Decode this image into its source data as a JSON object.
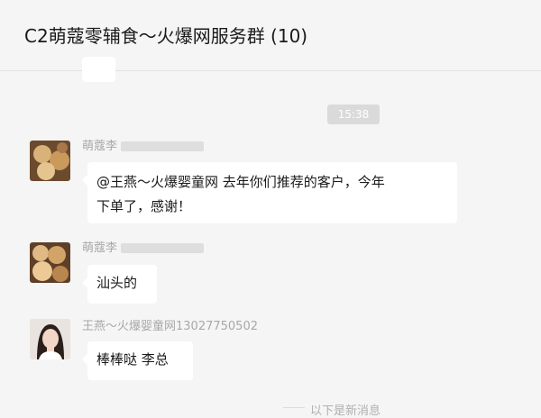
{
  "chat": {
    "title": "C2萌蔻零辅食～火爆网服务群 (10)"
  },
  "timestamp": "15:38",
  "messages": [
    {
      "sender": "萌蔻李",
      "text_line1": "@王燕～火爆婴童网 去年你们推荐的客户，今年",
      "text_line2": "下单了，感谢！",
      "avatar": "avatar-food"
    },
    {
      "sender": "萌蔻李",
      "text": "汕头的",
      "avatar": "avatar-food"
    },
    {
      "sender": "王燕～火爆婴童网13027750502",
      "text": "棒棒哒 李总",
      "avatar": "avatar-woman"
    }
  ],
  "new_messages_divider": "以下是新消息",
  "colors": {
    "background": "#f5f5f5",
    "bubble": "#ffffff",
    "time_pill": "#dadada",
    "name": "#a8a8a8"
  }
}
